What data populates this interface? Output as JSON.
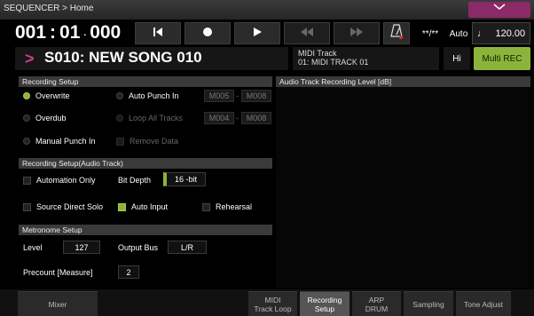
{
  "titlebar": {
    "title": "SEQUENCER > Home",
    "menu_icon": "chevron-down-icon"
  },
  "transport": {
    "locate": {
      "measure": "001",
      "beat": "01",
      "tick": "000"
    },
    "buttons": [
      "reset-icon",
      "record-icon",
      "play-icon",
      "rewind-icon",
      "fast-forward-icon"
    ],
    "metronome_icon": "metronome-icon",
    "time_signature": "**/**",
    "tempo_mode": "Auto",
    "tempo_note": "♩",
    "tempo": "120.00"
  },
  "song": {
    "arrow": ">",
    "name": "S010: NEW SONG 010"
  },
  "track": {
    "type": "MIDI Track",
    "name": "01: MIDI TRACK 01"
  },
  "hi_label": "Hi",
  "multi_rec": "Multi REC",
  "recording_setup": {
    "title": "Recording Setup",
    "overwrite": "Overwrite",
    "overdub": "Overdub",
    "manual_punch": "Manual Punch In",
    "auto_punch": "Auto Punch In",
    "auto_punch_from": "M005",
    "auto_punch_to": "M008",
    "loop_all": "Loop All Tracks",
    "loop_from": "M004",
    "loop_to": "M008",
    "remove_data": "Remove Data",
    "dash": "-"
  },
  "audio_level": {
    "title": "Audio Track Recording Level [dB]"
  },
  "recording_setup_audio": {
    "title": "Recording Setup(Audio Track)",
    "automation_only": "Automation Only",
    "bit_depth_label": "Bit Depth",
    "bit_depth_value": "16 -bit",
    "source_direct_solo": "Source Direct Solo",
    "auto_input": "Auto Input",
    "rehearsal": "Rehearsal"
  },
  "metronome": {
    "title": "Metronome Setup",
    "level_label": "Level",
    "level_value": "127",
    "output_bus_label": "Output Bus",
    "output_bus_value": "L/R",
    "precount_label": "Precount [Measure]",
    "precount_value": "2"
  },
  "tabs": [
    {
      "label": "Mixer"
    },
    {
      "label1": "MIDI",
      "label2": "Track Loop"
    },
    {
      "label1": "Recording",
      "label2": "Setup"
    },
    {
      "label1": "ARP",
      "label2": "DRUM"
    },
    {
      "label": "Sampling"
    },
    {
      "label": "Tone Adjust"
    }
  ],
  "colors": {
    "accent_green": "#8cb43c",
    "accent_magenta": "#8a2a66"
  }
}
